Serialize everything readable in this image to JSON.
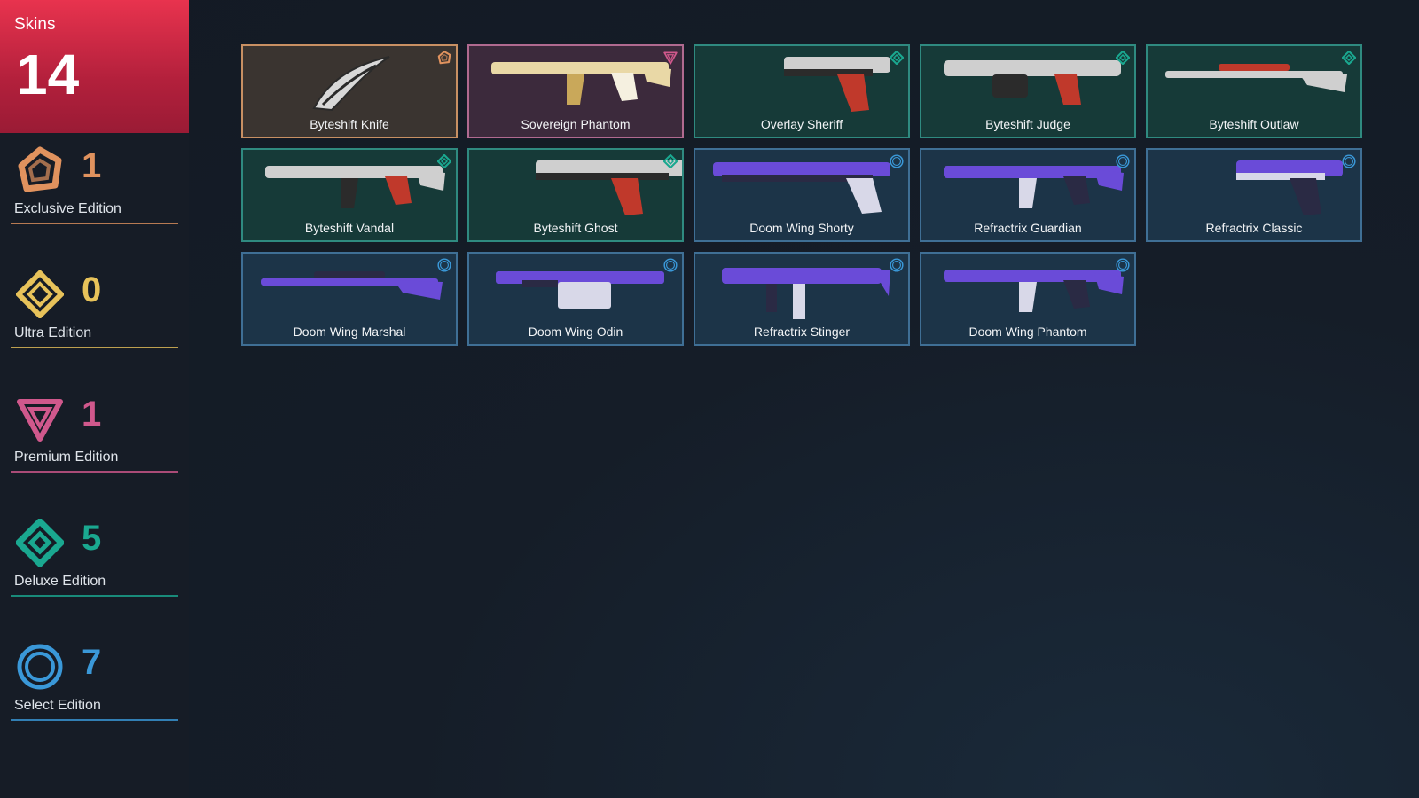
{
  "header": {
    "title": "Skins",
    "count": "14"
  },
  "editions": [
    {
      "label": "Exclusive Edition",
      "count": "1",
      "color": "#e0925e",
      "icon": "exclusive-edition-icon"
    },
    {
      "label": "Ultra Edition",
      "count": "0",
      "color": "#e7c25a",
      "icon": "ultra-edition-icon"
    },
    {
      "label": "Premium Edition",
      "count": "1",
      "color": "#d0588c",
      "icon": "premium-edition-icon"
    },
    {
      "label": "Deluxe Edition",
      "count": "5",
      "color": "#1aa890",
      "icon": "deluxe-edition-icon"
    },
    {
      "label": "Select Edition",
      "count": "7",
      "color": "#3a98d8",
      "icon": "select-edition-icon"
    }
  ],
  "skins": [
    {
      "name": "Byteshift Knife",
      "tier": "exclusive",
      "weapon": "knife"
    },
    {
      "name": "Sovereign Phantom",
      "tier": "premium",
      "weapon": "rifle"
    },
    {
      "name": "Overlay Sheriff",
      "tier": "deluxe",
      "weapon": "pistol"
    },
    {
      "name": "Byteshift Judge",
      "tier": "deluxe",
      "weapon": "shotgun"
    },
    {
      "name": "Byteshift Outlaw",
      "tier": "deluxe",
      "weapon": "sniper"
    },
    {
      "name": "Byteshift Vandal",
      "tier": "deluxe",
      "weapon": "rifle"
    },
    {
      "name": "Byteshift Ghost",
      "tier": "deluxe",
      "weapon": "pistol-long"
    },
    {
      "name": "Doom Wing Shorty",
      "tier": "select",
      "weapon": "shorty"
    },
    {
      "name": "Refractrix Guardian",
      "tier": "select",
      "weapon": "rifle"
    },
    {
      "name": "Refractrix Classic",
      "tier": "select",
      "weapon": "pistol"
    },
    {
      "name": "Doom Wing Marshal",
      "tier": "select",
      "weapon": "sniper"
    },
    {
      "name": "Doom Wing Odin",
      "tier": "select",
      "weapon": "lmg"
    },
    {
      "name": "Refractrix Stinger",
      "tier": "select",
      "weapon": "smg"
    },
    {
      "name": "Doom Wing Phantom",
      "tier": "select",
      "weapon": "rifle"
    }
  ]
}
